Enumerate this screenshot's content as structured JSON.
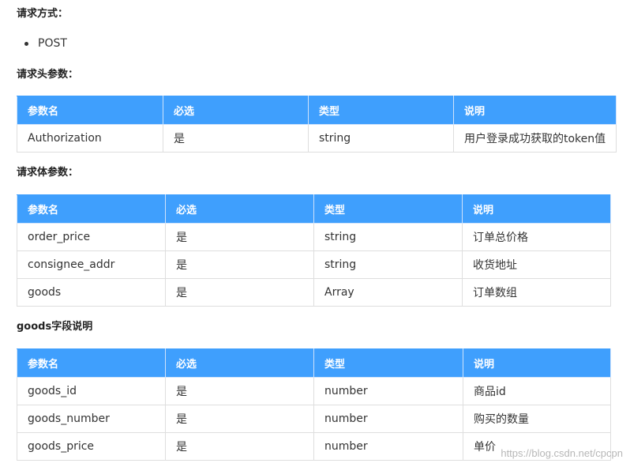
{
  "request_method": {
    "heading": "请求方式：",
    "items": [
      "POST"
    ]
  },
  "request_header": {
    "heading": "请求头参数：",
    "columns": [
      "参数名",
      "必选",
      "类型",
      "说明"
    ],
    "rows": [
      [
        "Authorization",
        "是",
        "string",
        "用户登录成功获取的token值"
      ]
    ]
  },
  "request_body": {
    "heading": "请求体参数：",
    "columns": [
      "参数名",
      "必选",
      "类型",
      "说明"
    ],
    "rows": [
      [
        "order_price",
        "是",
        "string",
        "订单总价格"
      ],
      [
        "consignee_addr",
        "是",
        "string",
        "收货地址"
      ],
      [
        "goods",
        "是",
        "Array",
        "订单数组"
      ]
    ]
  },
  "goods_fields": {
    "heading": "goods字段说明",
    "columns": [
      "参数名",
      "必选",
      "类型",
      "说明"
    ],
    "rows": [
      [
        "goods_id",
        "是",
        "number",
        "商品id"
      ],
      [
        "goods_number",
        "是",
        "number",
        "购买的数量"
      ],
      [
        "goods_price",
        "是",
        "number",
        "单价"
      ]
    ]
  },
  "watermark": "https://blog.csdn.net/cpcpn",
  "colors": {
    "header_bg": "#3f9ffd",
    "border": "#dedede",
    "text": "#333333"
  }
}
